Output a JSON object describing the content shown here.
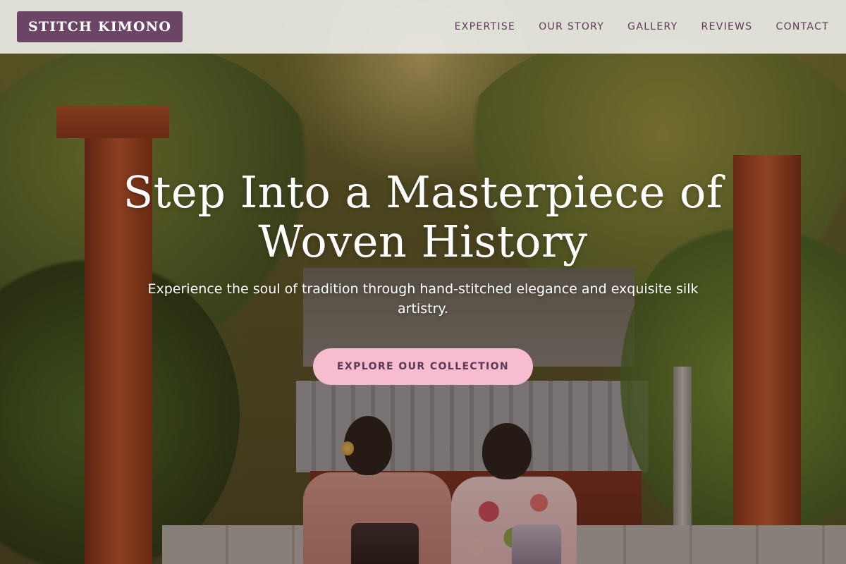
{
  "header": {
    "logo_text": "STITCH KIMONO",
    "nav": [
      {
        "label": "EXPERTISE"
      },
      {
        "label": "OUR STORY"
      },
      {
        "label": "GALLERY"
      },
      {
        "label": "REVIEWS"
      },
      {
        "label": "CONTACT"
      }
    ]
  },
  "hero": {
    "title": "Step Into a Masterpiece of Woven History",
    "subtitle": "Experience the soul of tradition through hand-stitched elegance and exquisite silk artistry.",
    "cta_label": "EXPLORE OUR COLLECTION"
  },
  "colors": {
    "brand_plum": "#6a4566",
    "nav_text": "#5a3a56",
    "cta_pink": "#f7bcd0",
    "header_bg": "#eae9e4"
  }
}
